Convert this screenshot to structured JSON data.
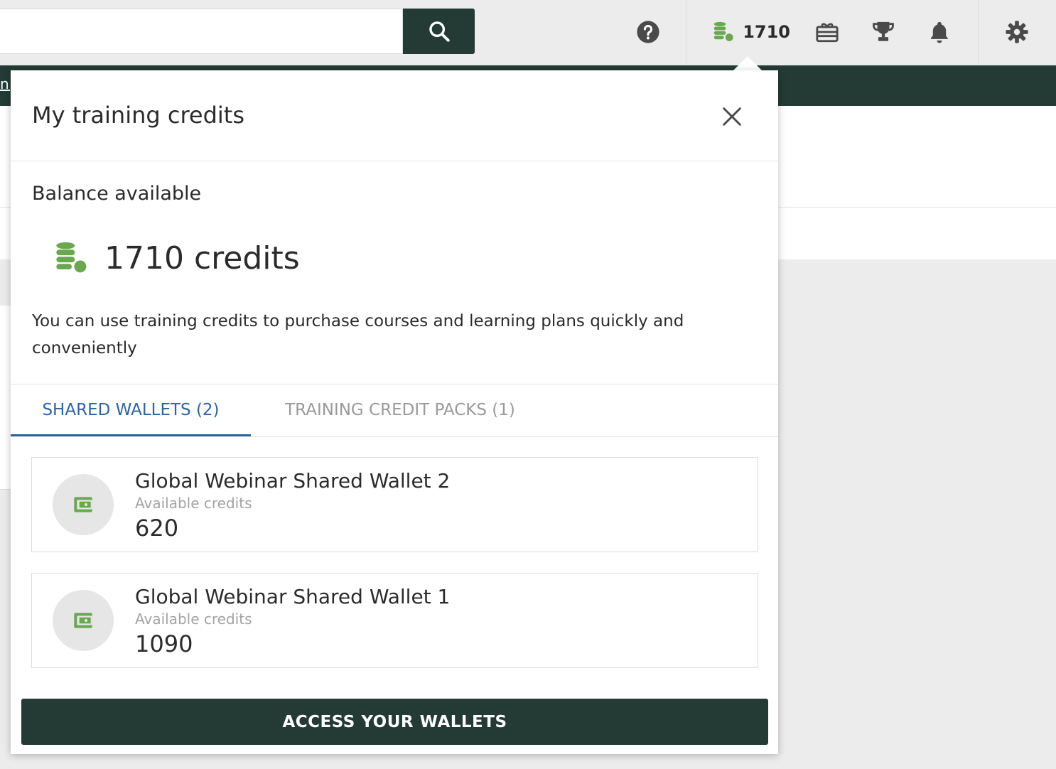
{
  "header": {
    "search": {
      "value": "",
      "placeholder": ""
    },
    "credits_count": "1710",
    "icons": [
      "help-icon",
      "coins-icon",
      "gift-icon",
      "trophy-icon",
      "bell-icon",
      "gear-icon"
    ]
  },
  "menubar": {
    "fragment": "na"
  },
  "popover": {
    "title": "My training credits",
    "balance_label": "Balance available",
    "balance_amount": "1710 credits",
    "description": "You can use training credits to purchase courses and learning plans quickly and conveniently",
    "tabs": [
      {
        "label": "SHARED WALLETS (2)",
        "active": true
      },
      {
        "label": "TRAINING CREDIT PACKS (1)",
        "active": false
      }
    ],
    "wallets": [
      {
        "name": "Global Webinar Shared Wallet 2",
        "sub": "Available credits",
        "value": "620"
      },
      {
        "name": "Global Webinar Shared Wallet 1",
        "sub": "Available credits",
        "value": "1090"
      }
    ],
    "action_label": "ACCESS YOUR WALLETS"
  },
  "colors": {
    "dark_green": "#233b34",
    "accent_blue": "#2f64a0",
    "coin_green": "#6aa84f"
  }
}
